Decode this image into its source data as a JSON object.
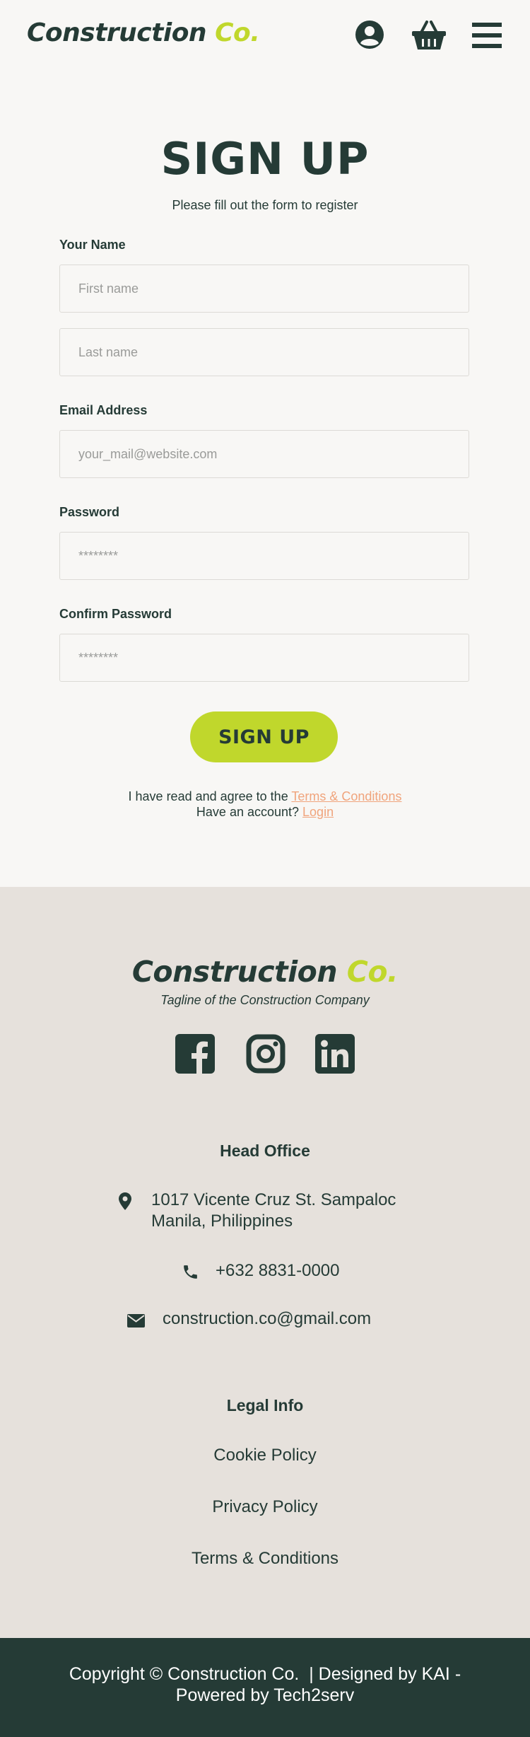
{
  "header": {
    "logo_main": "Construction",
    "logo_accent": "Co.",
    "icons": [
      "user-icon",
      "basket-icon",
      "menu-icon"
    ]
  },
  "form": {
    "title": "SIGN UP",
    "subtitle": "Please fill out the form to register",
    "name_label": "Your Name",
    "first_name_placeholder": "First name",
    "last_name_placeholder": "Last name",
    "email_label": "Email Address",
    "email_placeholder": "your_mail@website.com",
    "password_label": "Password",
    "password_placeholder": "********",
    "confirm_label": "Confirm Password",
    "confirm_placeholder": "********",
    "submit_label": "SIGN UP",
    "agree_text": "I have read and agree to the ",
    "terms_link": "Terms & Conditions",
    "account_text": "Have an account? ",
    "login_link": "Login"
  },
  "footer": {
    "logo_main": "Construction",
    "logo_accent": "Co.",
    "tagline": "Tagline of the Construction Company",
    "social_icons": [
      "facebook-icon",
      "instagram-icon",
      "linkedin-icon"
    ],
    "office_heading": "Head Office",
    "address_line1": "1017 Vicente Cruz St. Sampaloc",
    "address_line2": "Manila, Philippines",
    "phone": "+632 8831-0000",
    "email": "construction.co@gmail.com",
    "legal_heading": "Legal Info",
    "legal_links": [
      "Cookie Policy",
      "Privacy Policy",
      "Terms & Conditions"
    ],
    "copyright_line1": "Copyright © Construction Co.  | Designed by KAI -",
    "copyright_line2": "Powered by Tech2serv"
  },
  "colors": {
    "primary": "#253b36",
    "accent": "#c0d72c",
    "link": "#f0a47c",
    "page_bg": "#f8f7f5",
    "footer_bg": "#e6e1dc"
  }
}
